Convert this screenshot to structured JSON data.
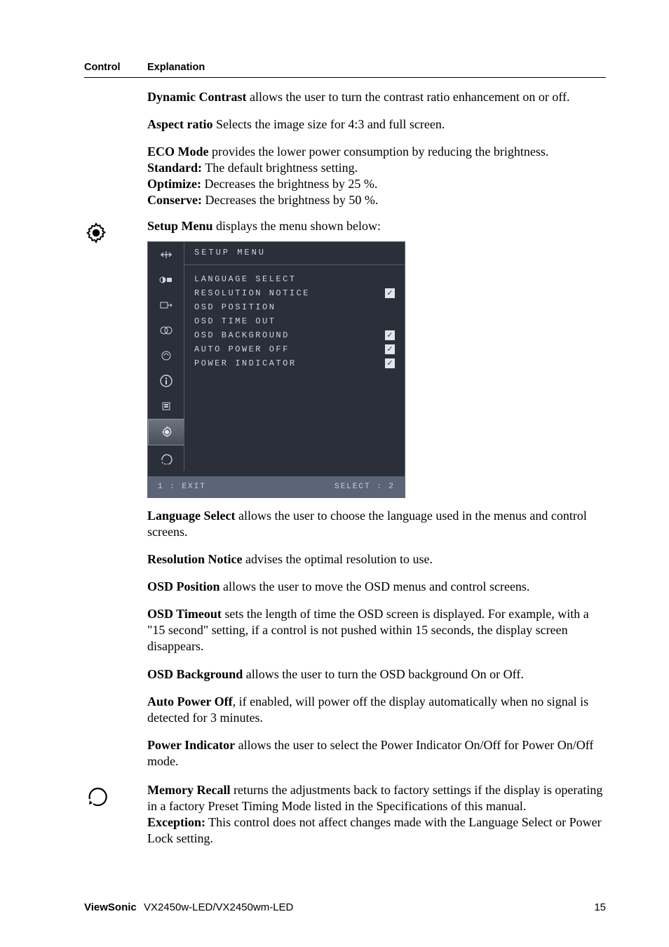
{
  "header": {
    "control": "Control",
    "explanation": "Explanation"
  },
  "section_misc": {
    "dynamic_contrast_label": "Dynamic Contrast",
    "dynamic_contrast_text": " allows the user to turn the contrast ratio enhancement on or off.",
    "aspect_ratio_label": "Aspect ratio",
    "aspect_ratio_text": " Selects the image size for 4:3 and full screen.",
    "eco_label": "ECO Mode",
    "eco_text": " provides the lower power consumption by reducing the brightness.",
    "standard_label": "Standard:",
    "standard_text": " The default brightness setting.",
    "optimize_label": "Optimize:",
    "optimize_text": " Decreases the brightness by 25 %.",
    "conserve_label": "Conserve:",
    "conserve_text": " Decreases the brightness by 50 %."
  },
  "section_setup": {
    "intro_label": "Setup Menu",
    "intro_text": " displays the menu shown below:",
    "lang_select_label": "Language Select",
    "lang_select_text": " allows the user to choose the language used in the menus and control screens.",
    "res_notice_label": "Resolution Notice",
    "res_notice_text": " advises the optimal resolution to use.",
    "osd_position_label": "OSD Position",
    "osd_position_text": " allows the user to move the OSD menus and control screens.",
    "osd_timeout_label": "OSD Timeout",
    "osd_timeout_text": " sets the length of time the OSD screen is displayed. For example, with a \"15 second\" setting, if a control is not pushed within 15 seconds, the display screen disappears.",
    "osd_background_label": "OSD Background",
    "osd_background_text": " allows the user to turn the OSD background On or Off.",
    "auto_power_off_label": "Auto Power Off",
    "auto_power_off_text": ", if enabled, will power off the display automatically when no signal is detected for 3 minutes.",
    "power_indicator_label": "Power Indicator",
    "power_indicator_text": " allows the user to select the Power Indicator On/Off for Power On/Off mode."
  },
  "section_memory": {
    "memory_recall_label": "Memory Recall",
    "memory_recall_text": " returns the adjustments back to factory settings if the display is operating in a factory Preset Timing Mode listed in the Specifications of this manual.",
    "exception_label": "Exception:",
    "exception_text": " This control does not affect changes made with the Language Select or Power Lock setting."
  },
  "osd": {
    "title": "SETUP MENU",
    "items": [
      {
        "label": "LANGUAGE SELECT",
        "check": false
      },
      {
        "label": "RESOLUTION NOTICE",
        "check": true
      },
      {
        "label": "OSD POSITION",
        "check": false
      },
      {
        "label": "OSD TIME OUT",
        "check": false
      },
      {
        "label": "OSD BACKGROUND",
        "check": true
      },
      {
        "label": "AUTO POWER OFF",
        "check": true
      },
      {
        "label": "POWER INDICATOR",
        "check": true
      }
    ],
    "footer_left": "1 : EXIT",
    "footer_right": "SELECT : 2"
  },
  "footer": {
    "brand": "ViewSonic",
    "model": "VX2450w-LED/VX2450wm-LED",
    "page_number": "15"
  }
}
